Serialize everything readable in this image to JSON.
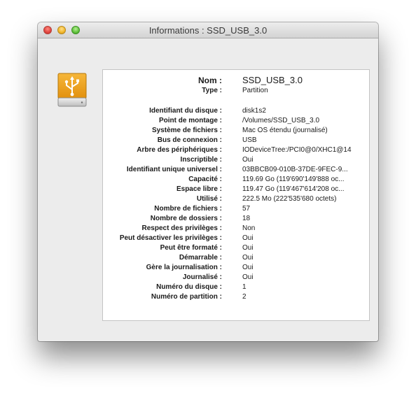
{
  "window": {
    "title": "Informations : SSD_USB_3.0"
  },
  "icon": {
    "name": "usb-drive-icon"
  },
  "colors": {
    "drive_orange": "#f0a11c",
    "drive_gray": "#d5d5d5"
  },
  "rows": [
    {
      "label": "Nom :",
      "value": "SSD_USB_3.0"
    },
    {
      "label": "Type :",
      "value": "Partition"
    },
    {
      "label": "Identifiant du disque :",
      "value": "disk1s2"
    },
    {
      "label": "Point de montage :",
      "value": "/Volumes/SSD_USB_3.0"
    },
    {
      "label": "Système de fichiers :",
      "value": "Mac OS étendu (journalisé)"
    },
    {
      "label": "Bus de connexion :",
      "value": "USB"
    },
    {
      "label": "Arbre des périphériques :",
      "value": "IODeviceTree:/PCI0@0/XHC1@14"
    },
    {
      "label": "Inscriptible :",
      "value": "Oui"
    },
    {
      "label": "Identifiant unique universel :",
      "value": "03BBCB09-010B-37DE-9FEC-9..."
    },
    {
      "label": "Capacité :",
      "value": "119.69 Go (119'690'149'888 oc..."
    },
    {
      "label": "Espace libre :",
      "value": "119.47 Go (119'467'614'208 oc..."
    },
    {
      "label": "Utilisé :",
      "value": "222.5 Mo (222'535'680 octets)"
    },
    {
      "label": "Nombre de fichiers :",
      "value": "57"
    },
    {
      "label": "Nombre de dossiers :",
      "value": "18"
    },
    {
      "label": "Respect des privilèges :",
      "value": "Non"
    },
    {
      "label": "Peut désactiver les privilèges :",
      "value": "Oui"
    },
    {
      "label": "Peut être formaté :",
      "value": "Oui"
    },
    {
      "label": "Démarrable :",
      "value": "Oui"
    },
    {
      "label": "Gère la journalisation :",
      "value": "Oui"
    },
    {
      "label": "Journalisé :",
      "value": "Oui"
    },
    {
      "label": "Numéro du disque :",
      "value": "1"
    },
    {
      "label": "Numéro de partition :",
      "value": "2"
    }
  ]
}
